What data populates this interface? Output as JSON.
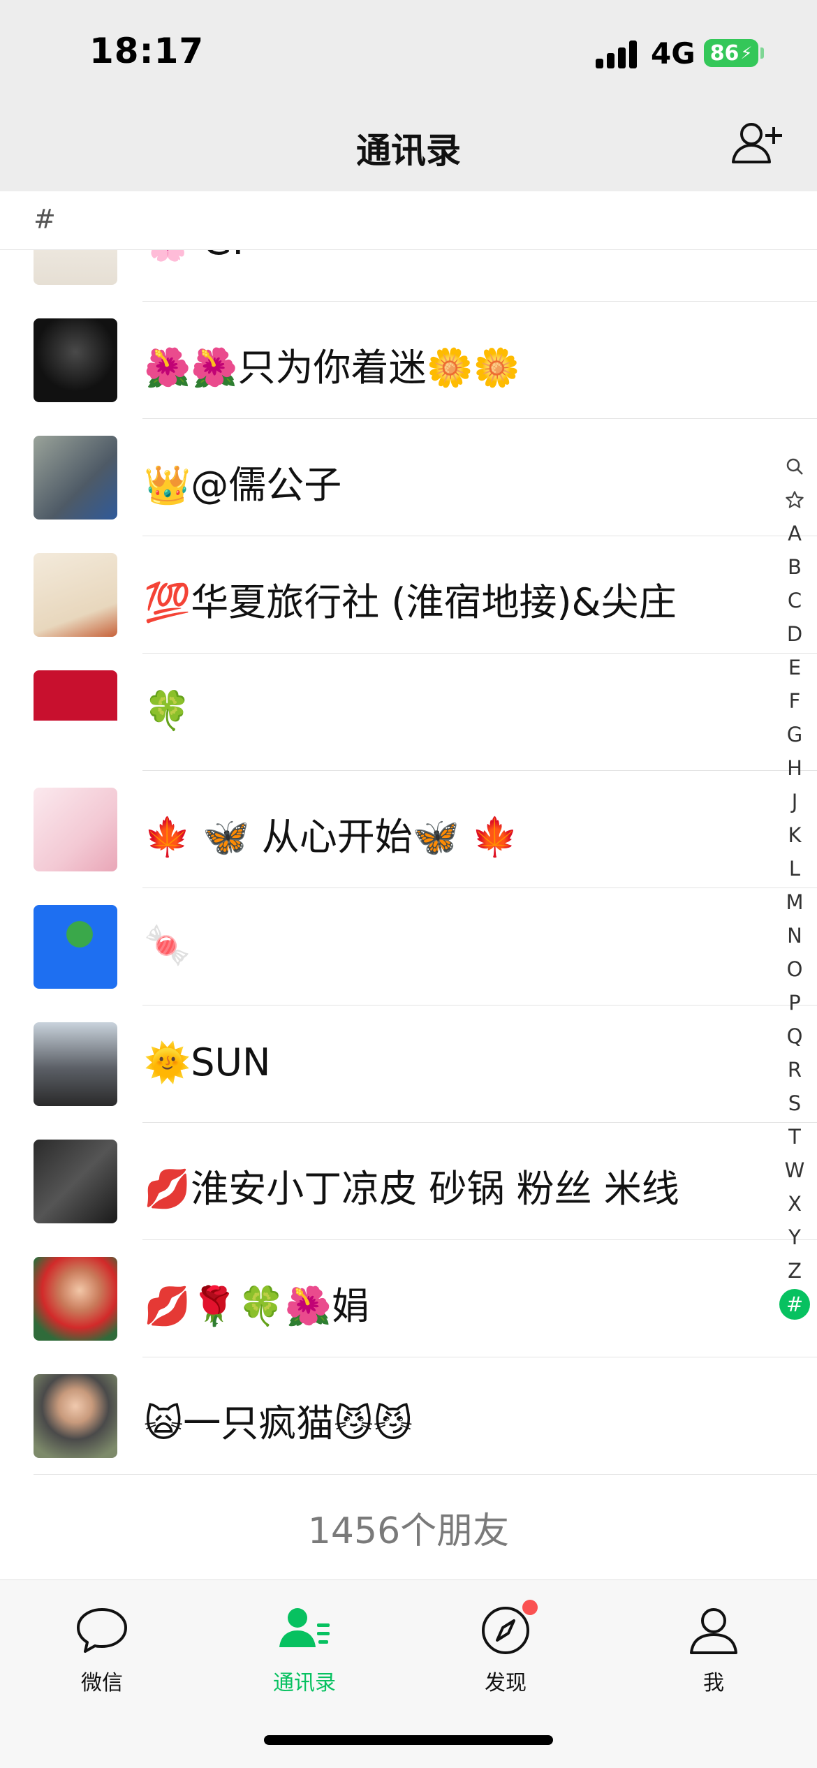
{
  "status_bar": {
    "time": "18:17",
    "network": "4G",
    "battery": "86"
  },
  "header": {
    "title": "通讯录",
    "add_friend_icon": "add-friend-icon"
  },
  "section": {
    "label": "#"
  },
  "contacts": [
    {
      "name": "🌸  G."
    },
    {
      "name": "🌺🌺只为你着迷🌼🌼"
    },
    {
      "name": "👑@儒公子"
    },
    {
      "name": "💯华夏旅行社 (淮宿地接)&尖庄"
    },
    {
      "name": "🍀"
    },
    {
      "name": "🍁 🦋 从心开始🦋 🍁"
    },
    {
      "name": "🍬"
    },
    {
      "name": "🌞SUN"
    },
    {
      "name": "💋淮安小丁凉皮 砂锅 粉丝 米线"
    },
    {
      "name": "💋🌹🍀🌺娟"
    },
    {
      "name": "🙀一只疯猫😼😼"
    }
  ],
  "friend_count": "1456个朋友",
  "index_bar": [
    "search",
    "star",
    "A",
    "B",
    "C",
    "D",
    "E",
    "F",
    "G",
    "H",
    "J",
    "K",
    "L",
    "M",
    "N",
    "O",
    "P",
    "Q",
    "R",
    "S",
    "T",
    "W",
    "X",
    "Y",
    "Z",
    "#"
  ],
  "index_active": "#",
  "tabs": [
    {
      "label": "微信",
      "icon": "chat-bubble-icon"
    },
    {
      "label": "通讯录",
      "icon": "contacts-icon",
      "active": true
    },
    {
      "label": "发现",
      "icon": "compass-icon",
      "badge": true
    },
    {
      "label": "我",
      "icon": "person-icon"
    }
  ],
  "colors": {
    "accent": "#07c160",
    "badge": "#fa5151",
    "battery": "#34c759"
  }
}
